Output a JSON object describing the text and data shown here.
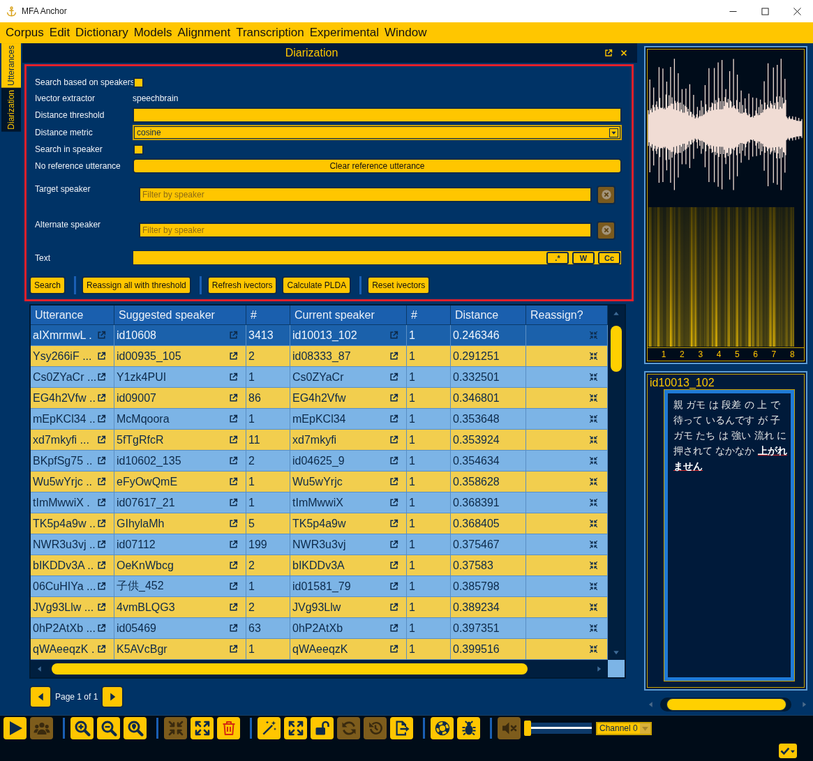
{
  "window": {
    "title": "MFA Anchor"
  },
  "menu": [
    "Corpus",
    "Edit",
    "Dictionary",
    "Models",
    "Alignment",
    "Transcription",
    "Experimental",
    "Window"
  ],
  "side_tabs": [
    {
      "label": "Utterances",
      "selected": false
    },
    {
      "label": "Diarization",
      "selected": true
    }
  ],
  "panel": {
    "title": "Diarization"
  },
  "form": {
    "rows": [
      {
        "kind": "checkbox",
        "label": "Search based on speakers",
        "checked": false
      },
      {
        "kind": "value",
        "label": "Ivector extractor",
        "value": "speechbrain"
      },
      {
        "kind": "input",
        "label": "Distance threshold"
      },
      {
        "kind": "select",
        "label": "Distance metric",
        "value": "cosine"
      },
      {
        "kind": "checkbox",
        "label": "Search in speaker",
        "checked": false
      },
      {
        "kind": "button",
        "label": "No reference utterance",
        "button": "Clear reference utterance"
      },
      {
        "kind": "filter",
        "label": "Target speaker",
        "placeholder": "Filter by speaker",
        "clear_disabled": true
      },
      {
        "kind": "filter",
        "label": "Alternate speaker",
        "placeholder": "Filter by speaker",
        "clear_disabled": true
      },
      {
        "kind": "search",
        "label": "Text",
        "options": [
          ".*",
          "W",
          "Cc"
        ]
      }
    ],
    "actions": [
      [
        "Search"
      ],
      [
        "Reassign all with threshold"
      ],
      [
        "Refresh ivectors",
        "Calculate PLDA"
      ],
      [
        "Reset ivectors"
      ]
    ]
  },
  "table": {
    "columns": [
      "Utterance",
      "Suggested speaker",
      "#",
      "Current speaker",
      "#",
      "Distance",
      "Reassign?"
    ],
    "rows": [
      {
        "utterance": "aIXmrmwL .",
        "suggested_speaker": "id10608",
        "suggested_count": "3413",
        "current_speaker": "id10013_102",
        "current_count": "1",
        "distance": "0.246346",
        "selected": true
      },
      {
        "utterance": "Ysy266iF ...",
        "suggested_speaker": "id00935_105",
        "suggested_count": "2",
        "current_speaker": "id08333_87",
        "current_count": "1",
        "distance": "0.291251",
        "selected": false
      },
      {
        "utterance": "Cs0ZYaCr ...",
        "suggested_speaker": "Y1zk4PUI",
        "suggested_count": "1",
        "current_speaker": "Cs0ZYaCr",
        "current_count": "1",
        "distance": "0.332501",
        "selected": false
      },
      {
        "utterance": "EG4h2Vfw ..",
        "suggested_speaker": "id09007",
        "suggested_count": "86",
        "current_speaker": "EG4h2Vfw",
        "current_count": "1",
        "distance": "0.346801",
        "selected": false
      },
      {
        "utterance": "mEpKCl34 ..",
        "suggested_speaker": "McMqoora",
        "suggested_count": "1",
        "current_speaker": "mEpKCl34",
        "current_count": "1",
        "distance": "0.353648",
        "selected": false
      },
      {
        "utterance": "xd7mkyfi ...",
        "suggested_speaker": "5fTgRfcR",
        "suggested_count": "11",
        "current_speaker": "xd7mkyfi",
        "current_count": "1",
        "distance": "0.353924",
        "selected": false
      },
      {
        "utterance": "BKpfSg75 ..",
        "suggested_speaker": "id10602_135",
        "suggested_count": "2",
        "current_speaker": "id04625_9",
        "current_count": "1",
        "distance": "0.354634",
        "selected": false
      },
      {
        "utterance": "Wu5wYrjc ..",
        "suggested_speaker": "eFyOwQmE",
        "suggested_count": "1",
        "current_speaker": "Wu5wYrjc",
        "current_count": "1",
        "distance": "0.358628",
        "selected": false
      },
      {
        "utterance": "tImMwwiX .",
        "suggested_speaker": "id07617_21",
        "suggested_count": "1",
        "current_speaker": "tImMwwiX",
        "current_count": "1",
        "distance": "0.368391",
        "selected": false
      },
      {
        "utterance": "TK5p4a9w ..",
        "suggested_speaker": "GIhylaMh",
        "suggested_count": "5",
        "current_speaker": "TK5p4a9w",
        "current_count": "1",
        "distance": "0.368405",
        "selected": false
      },
      {
        "utterance": "NWR3u3vj ..",
        "suggested_speaker": "id07112",
        "suggested_count": "199",
        "current_speaker": "NWR3u3vj",
        "current_count": "1",
        "distance": "0.375467",
        "selected": false
      },
      {
        "utterance": "bIKDDv3A ..",
        "suggested_speaker": "OeKnWbcg",
        "suggested_count": "2",
        "current_speaker": "bIKDDv3A",
        "current_count": "1",
        "distance": "0.37583",
        "selected": false
      },
      {
        "utterance": "06CuHIYa ...",
        "suggested_speaker": "子供_452",
        "suggested_count": "1",
        "current_speaker": "id01581_79",
        "current_count": "1",
        "distance": "0.385798",
        "selected": false
      },
      {
        "utterance": "JVg93Llw ...",
        "suggested_speaker": "4vmBLQG3",
        "suggested_count": "2",
        "current_speaker": "JVg93Llw",
        "current_count": "1",
        "distance": "0.389234",
        "selected": false
      },
      {
        "utterance": "0hP2AtXb ...",
        "suggested_speaker": "id05469",
        "suggested_count": "63",
        "current_speaker": "0hP2AtXb",
        "current_count": "1",
        "distance": "0.397351",
        "selected": false
      },
      {
        "utterance": "qWAeeqzK .",
        "suggested_speaker": "K5AVcBgr",
        "suggested_count": "1",
        "current_speaker": "qWAeeqzK",
        "current_count": "1",
        "distance": "0.399516",
        "selected": false
      }
    ]
  },
  "pager": {
    "label": "Page 1 of 1"
  },
  "audio": {
    "ticks": [
      "1",
      "2",
      "3",
      "4",
      "5",
      "6",
      "7",
      "8"
    ]
  },
  "transcript": {
    "speaker": "id10013_102",
    "text": "親 ガモ は 段差 の 上 で待って いるんです が 子ガモ たち は 強い 流れ に押されて なかなか **上がれません**"
  },
  "toolbar": {
    "groups": [
      [
        {
          "disabled": false
        },
        {
          "disabled": true
        }
      ],
      [
        {
          "disabled": false
        },
        {
          "disabled": false
        },
        {
          "disabled": false
        }
      ],
      [
        {
          "disabled": true
        },
        {
          "disabled": false
        },
        {
          "disabled": false
        }
      ],
      [
        {
          "disabled": false
        },
        {
          "disabled": false
        },
        {
          "disabled": false
        },
        {
          "disabled": true
        },
        {
          "disabled": true
        },
        {
          "disabled": false
        }
      ],
      [
        {
          "disabled": false
        },
        {
          "disabled": false
        }
      ],
      [
        {
          "disabled": true
        }
      ]
    ],
    "volume": {
      "level": 0
    },
    "channel": "Channel 0"
  }
}
